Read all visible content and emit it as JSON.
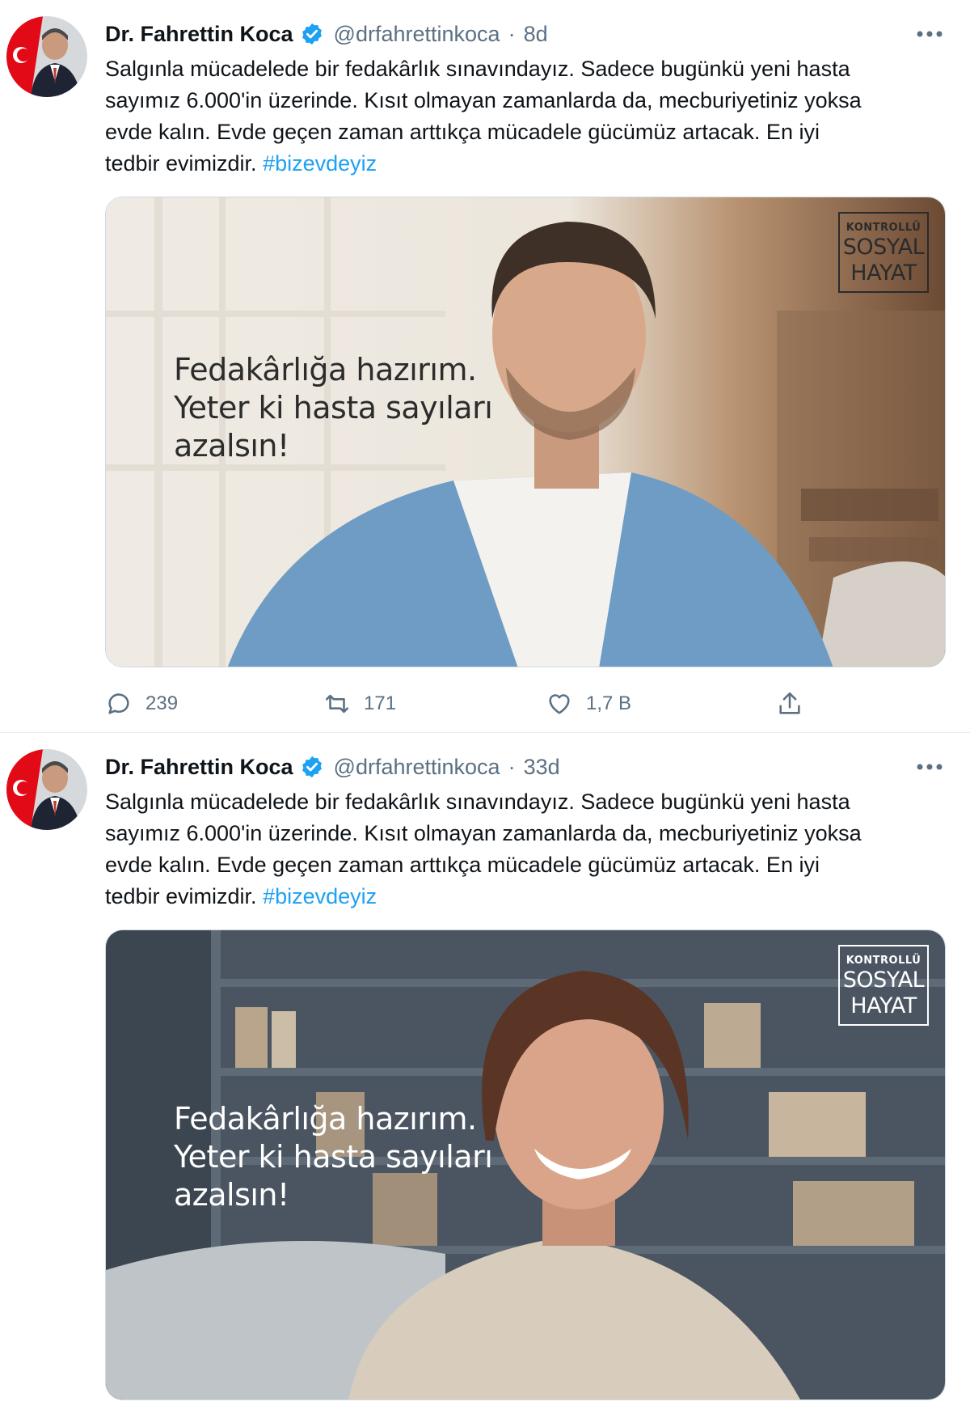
{
  "tweets": [
    {
      "author_name": "Dr. Fahrettin Koca",
      "handle": "@drfahrettinkoca",
      "separator": "·",
      "time": "8d",
      "text_lines": [
        "Salgınla mücadelede bir fedakârlık sınavındayız. Sadece bugünkü yeni hasta",
        "sayımız 6.000'in üzerinde. Kısıt olmayan zamanlarda da, mecburiyetiniz yoksa",
        "evde kalın. Evde geçen zaman arttıkça mücadele gücümüz artacak. En iyi",
        "tedbir evimizdir."
      ],
      "hashtag": "#bizevdeyiz",
      "media": {
        "badge": [
          "KONTROLLÜ",
          "SOSYAL",
          "HAYAT"
        ],
        "caption": [
          "Fedakârlığa hazırım.",
          "Yeter ki hasta sayıları",
          "azalsın!"
        ]
      },
      "replies": "239",
      "retweets": "171",
      "likes": "1,7 B",
      "icons": [
        "verified-icon",
        "more-icon",
        "reply-icon",
        "retweet-icon",
        "like-icon",
        "share-icon"
      ]
    },
    {
      "author_name": "Dr. Fahrettin Koca",
      "handle": "@drfahrettinkoca",
      "separator": "·",
      "time": "33d",
      "text_lines": [
        "Salgınla mücadelede bir fedakârlık sınavındayız. Sadece bugünkü yeni hasta",
        "sayımız 6.000'in üzerinde. Kısıt olmayan zamanlarda da, mecburiyetiniz yoksa",
        "evde kalın. Evde geçen zaman arttıkça mücadele gücümüz artacak. En iyi",
        "tedbir evimizdir."
      ],
      "hashtag": "#bizevdeyiz",
      "media": {
        "badge": [
          "KONTROLLÜ",
          "SOSYAL",
          "HAYAT"
        ],
        "caption": [
          "Fedakârlığa hazırım.",
          "Yeter ki hasta sayıları",
          "azalsın!"
        ]
      },
      "icons": [
        "verified-icon",
        "more-icon"
      ]
    }
  ],
  "colors": {
    "text": "#0f1419",
    "secondary": "#5b7083",
    "link": "#1da1f2",
    "verified": "#1da1f2",
    "divider": "#e6ecf0"
  }
}
